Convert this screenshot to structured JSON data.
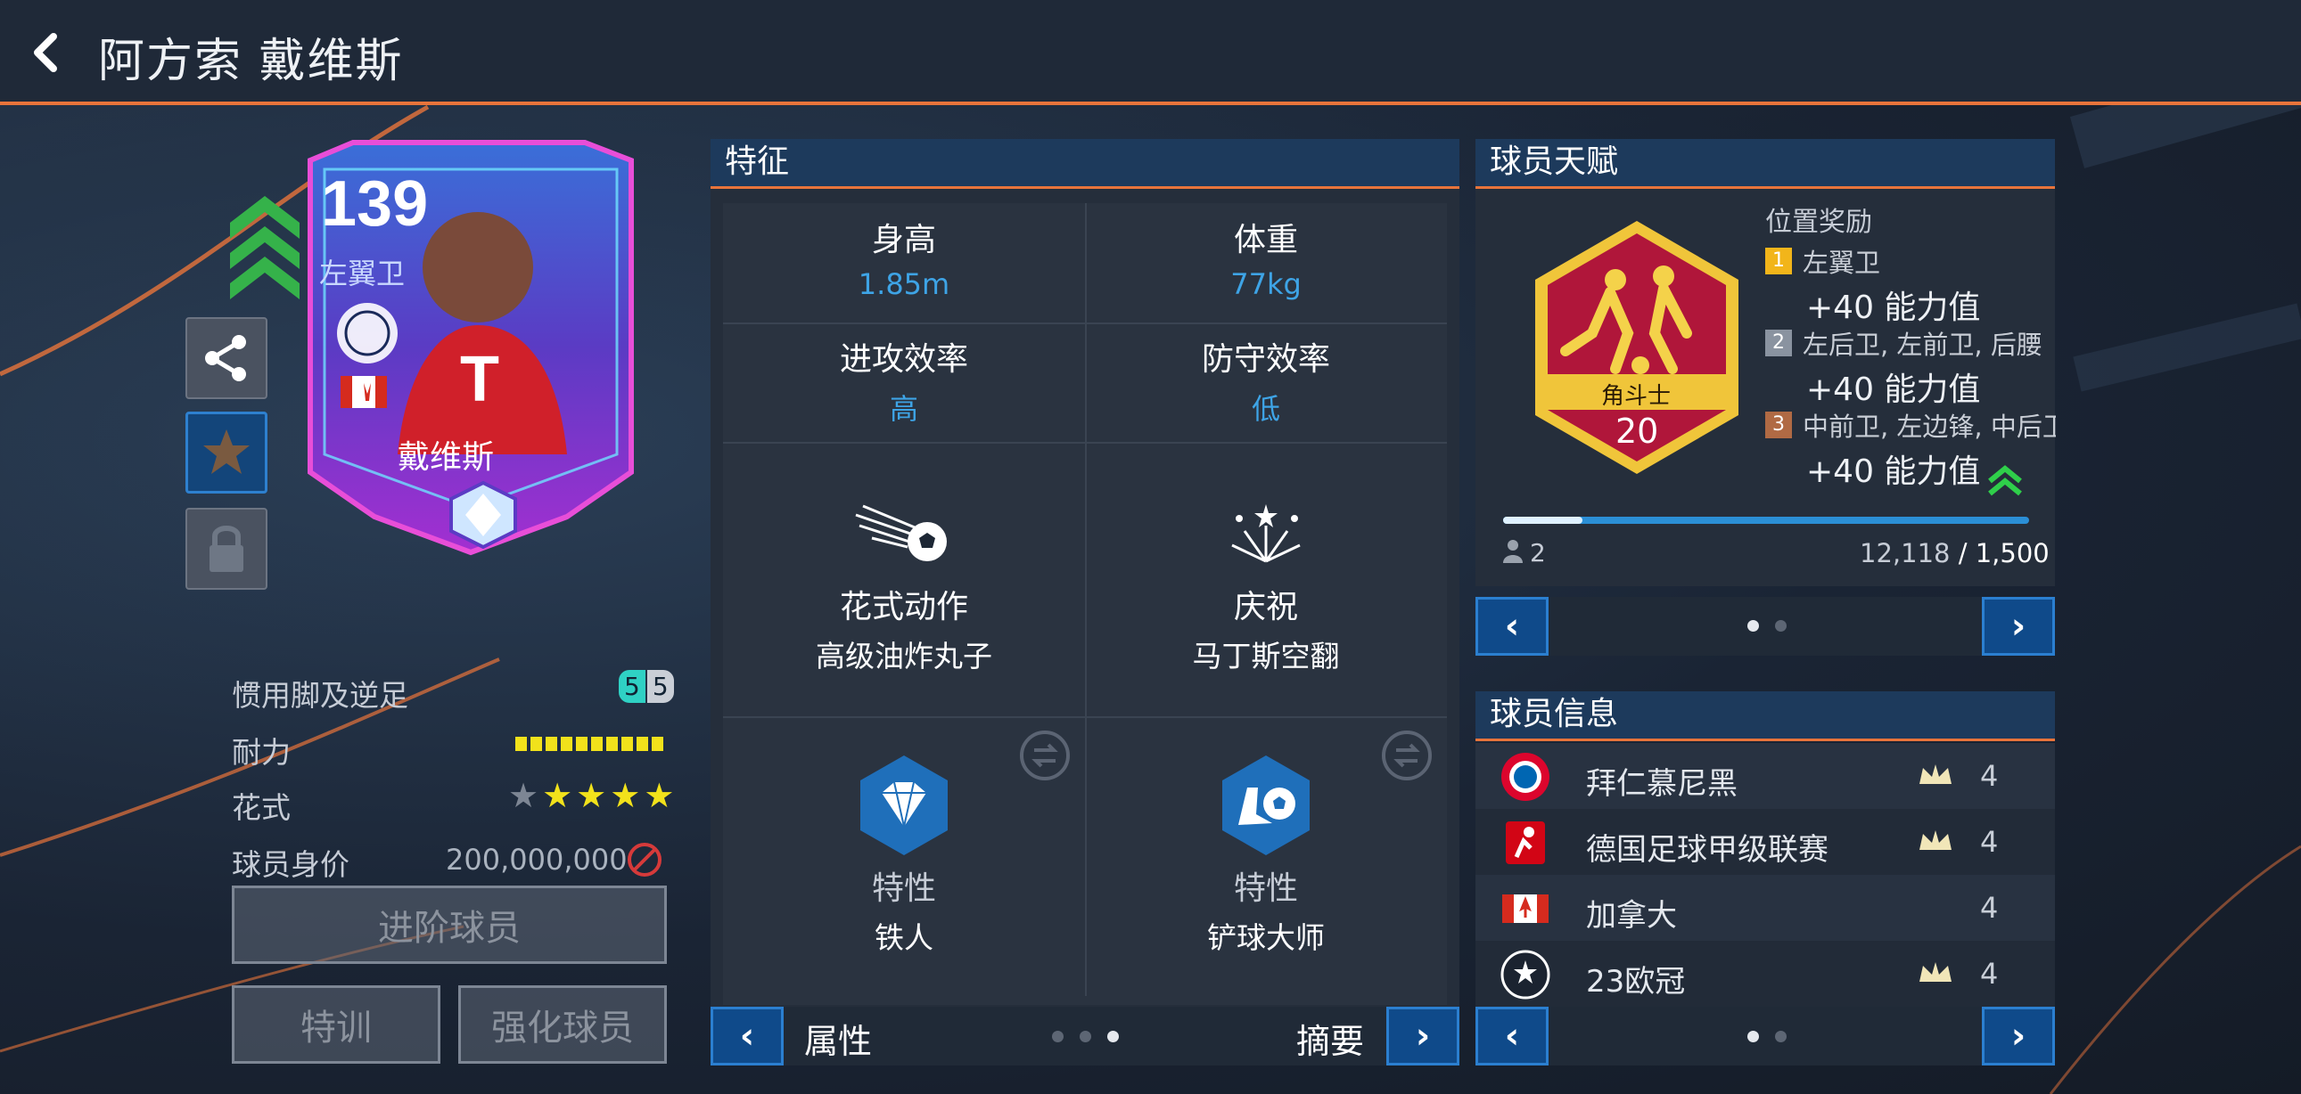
{
  "header": {
    "title": "阿方索 戴维斯"
  },
  "card": {
    "rating": "139",
    "position": "左翼卫",
    "name": "戴维斯"
  },
  "stats": {
    "foot_label": "惯用脚及逆足",
    "foot_strong": "5",
    "foot_weak": "5",
    "stamina_label": "耐力",
    "stamina_level": 1.0,
    "skill_label": "花式",
    "skill_moves": 4,
    "skill_moves_max": 5,
    "value_label": "球员身价",
    "value": "200,000,000"
  },
  "buttons": {
    "advance": "进阶球员",
    "train": "特训",
    "enhance": "强化球员"
  },
  "features": {
    "title": "特征",
    "height_label": "身高",
    "height_value": "1.85m",
    "weight_label": "体重",
    "weight_value": "77kg",
    "attack_label": "进攻效率",
    "attack_value": "高",
    "defense_label": "防守效率",
    "defense_value": "低",
    "skill_label": "花式动作",
    "skill_value": "高级油炸丸子",
    "celebration_label": "庆祝",
    "celebration_value": "马丁斯空翻",
    "trait1_label": "特性",
    "trait1_value": "铁人",
    "trait2_label": "特性",
    "trait2_value": "铲球大师",
    "nav_left": "属性",
    "nav_right": "摘要"
  },
  "talent": {
    "title": "球员天赋",
    "badge_name": "角斗士",
    "badge_level": "20",
    "reward_title": "位置奖励",
    "rewards": [
      {
        "rank": "1",
        "positions": "左翼卫",
        "bonus": "+40 能力值"
      },
      {
        "rank": "2",
        "positions": "左后卫, 左前卫, 后腰",
        "bonus": "+40 能力值"
      },
      {
        "rank": "3",
        "positions": "中前卫, 左边锋, 中后卫",
        "bonus": "+40 能力值"
      }
    ],
    "count": "2",
    "progress_current": "12,118",
    "progress_sep": " / ",
    "progress_total": "1,500",
    "progress_fill": 0.15
  },
  "info": {
    "title": "球员信息",
    "rows": [
      {
        "name": "拜仁慕尼黑",
        "level": "4"
      },
      {
        "name": "德国足球甲级联赛",
        "level": "4"
      },
      {
        "name": "加拿大",
        "level": "4"
      },
      {
        "name": "23欧冠",
        "level": "4"
      }
    ]
  },
  "colors": {
    "accent": "#e8743b",
    "blue": "#3ea4e6",
    "panel": "#1d3a5c",
    "nav": "#0f4a8a"
  },
  "icons": [
    "back-chevron-icon",
    "share-icon",
    "star-icon",
    "lock-icon",
    "no-trade-icon",
    "ball-kick-icon",
    "fireworks-icon",
    "diamond-icon",
    "tackle-icon",
    "swap-icon",
    "crown-icon",
    "player-count-icon"
  ]
}
